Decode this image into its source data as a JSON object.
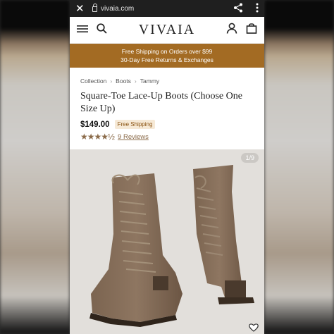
{
  "browser": {
    "close_glyph": "✕",
    "url": "vivaia.com",
    "share_icon": "share-icon",
    "menu_icon": "kebab-menu-icon"
  },
  "header": {
    "logo": "VIVAIA",
    "icons": [
      "hamburger-icon",
      "search-icon",
      "account-icon",
      "bag-icon"
    ]
  },
  "promo": {
    "line1": "Free Shipping on Orders over $99",
    "line2": "30-Day Free Returns & Exchanges",
    "bg_color": "#a36b23"
  },
  "breadcrumb": [
    "Collection",
    "Boots",
    "Tammy"
  ],
  "product": {
    "title": "Square-Toe Lace-Up Boots (Choose One Size Up)",
    "price": "$149.00",
    "badge": "Free Shipping",
    "stars": "★★★★½",
    "rating": 4.5,
    "reviews": "9 Reviews"
  },
  "gallery": {
    "counter": "1/9",
    "image": "taupe knit square-toe lace-up boots",
    "heart_icon": "heart-icon"
  }
}
